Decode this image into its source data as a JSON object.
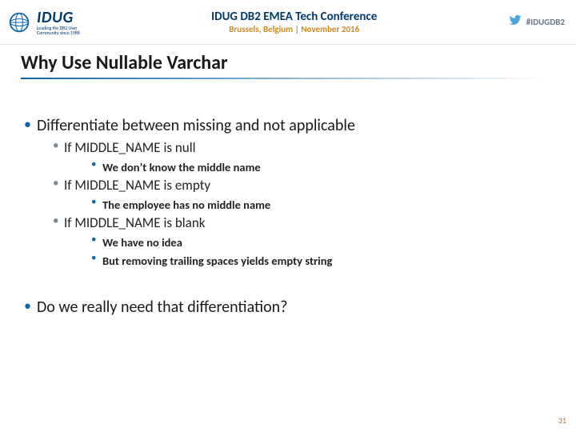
{
  "header": {
    "logo_text": "IDUG",
    "logo_sub1": "Leading the DB2 User",
    "logo_sub2": "Community since 1988",
    "conf_title": "IDUG DB2 EMEA Tech Conference",
    "conf_sub": "Brussels, Belgium  |  November 2016",
    "hashtag": "#IDUGDB2"
  },
  "title": "Why Use Nullable Varchar",
  "points": {
    "p1": "Differentiate between missing and not applicable",
    "p1a": "If MIDDLE_NAME is null",
    "p1a1": "We don’t know the middle name",
    "p1b": "If MIDDLE_NAME is empty",
    "p1b1": "The employee has no middle name",
    "p1c": "If MIDDLE_NAME is blank",
    "p1c1": "We have no idea",
    "p1c2": "But removing trailing spaces yields empty string",
    "p2": "Do we really need that differentiation?"
  },
  "page_number": "31"
}
